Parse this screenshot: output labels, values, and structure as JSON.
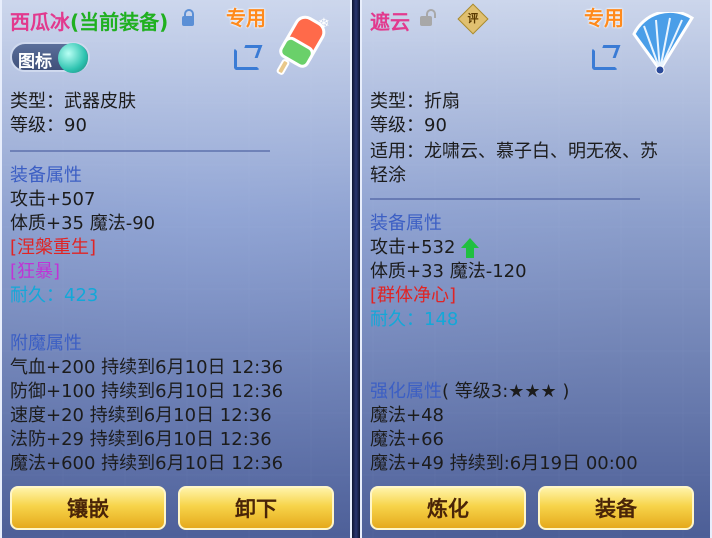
{
  "left": {
    "name": "西瓜冰",
    "status": "(当前装备)",
    "tag": "专用",
    "icon_toggle_label": "图标",
    "type_line": "类型：武器皮肤",
    "level_line": "等级：90",
    "section_attr": "装备属性",
    "attack": "攻击+507",
    "body_magic": "体质+35 魔法-90",
    "skill1": "[涅槃重生]",
    "skill2": "[狂暴]",
    "durability": "耐久：423",
    "section_enchant": "附魔属性",
    "enchants": [
      "气血+200 持续到6月10日 12:36",
      "防御+100 持续到6月10日 12:36",
      "速度+20 持续到6月10日 12:36",
      "法防+29 持续到6月10日 12:36",
      "魔法+600 持续到6月10日 12:36"
    ],
    "btn_inlay": "镶嵌",
    "btn_unequip": "卸下"
  },
  "right": {
    "name": "遮云",
    "badge": "评",
    "tag": "专用",
    "type_line": "类型：折扇",
    "level_line": "等级：90",
    "suitable_line1": "适用：龙啸云、慕子白、明无夜、苏",
    "suitable_line2": "轻涂",
    "section_attr": "装备属性",
    "attack": "攻击+532",
    "body_magic": "体质+33 魔法-120",
    "skill1": "[群体净心]",
    "durability": "耐久：148",
    "section_strengthen": "强化属性",
    "strengthen_level": "( 等级3:★★★ )",
    "strengthen": [
      "魔法+48",
      "魔法+66",
      "魔法+49     持续到:6月19日 00:00"
    ],
    "btn_refine": "炼化",
    "btn_equip": "装备"
  },
  "colors": {
    "title_pink": "#e23a8e",
    "status_green": "#20b020",
    "tag_orange": "#ff8a1c",
    "section_blue": "#3c5fc4",
    "skill_red": "#e02424",
    "skill_magenta": "#c033d6",
    "durability_cyan": "#13a8d8",
    "button_gold": "#f7d44a"
  }
}
